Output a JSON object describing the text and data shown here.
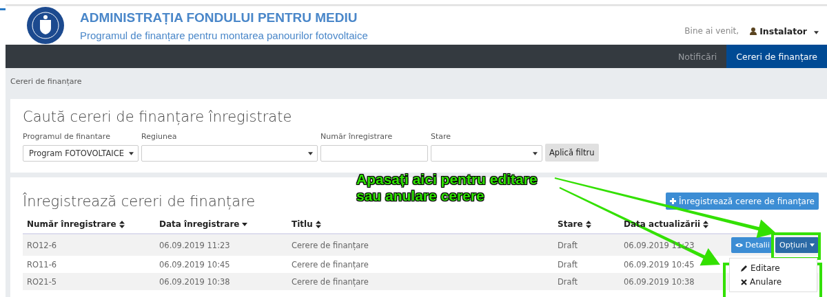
{
  "header": {
    "title": "ADMINISTRAȚIA FONDULUI PENTRU MEDIU",
    "subtitle": "Programul de finanțare pentru montarea panourilor fotovoltaice",
    "greeting": "Bine ai venit,",
    "user": "Instalator"
  },
  "nav": [
    {
      "label": "Notificări",
      "selected": false
    },
    {
      "label": "Cereri de finanțare",
      "selected": true
    }
  ],
  "breadcrumb": "Cereri de finanțare",
  "search": {
    "title": "Caută cereri de finanțare înregistrate",
    "fields": [
      {
        "kind": "select",
        "label": "Programul de finantare",
        "value": "Program FOTOVOLTAICE"
      },
      {
        "kind": "select",
        "label": "Regiunea"
      },
      {
        "kind": "input",
        "label": "Număr înregistrare"
      },
      {
        "kind": "select",
        "label": "Stare"
      }
    ],
    "apply_button": "Aplică filtru"
  },
  "list": {
    "title": "Înregistrează cereri de finanțare",
    "add_button": "Înregistrează cerere de finanțare",
    "columns": [
      {
        "label": "Număr înregistrare",
        "sorted": false
      },
      {
        "label": "Data înregistrare",
        "sorted": true
      },
      {
        "label": "Titlu",
        "sorted": false
      },
      {
        "label": "Stare",
        "sorted": false
      },
      {
        "label": "Data actualizării",
        "sorted": false
      }
    ],
    "rows": [
      {
        "cells": [
          "RO12-6",
          "06.09.2019 11:23",
          "Cerere de finanțare",
          "Draft",
          "06.09.2019 11:23"
        ],
        "details_button": "Detalii",
        "options_button": "Opțiuni",
        "menu": [
          {
            "kind": "edit",
            "label": "Editare"
          },
          {
            "kind": "cancel",
            "label": "Anulare"
          }
        ]
      },
      {
        "cells": [
          "RO11-6",
          "06.09.2019 10:45",
          "Cerere de finanțare",
          "Draft",
          "06.09.2019 10:45"
        ]
      },
      {
        "cells": [
          "RO21-5",
          "06.09.2019 10:38",
          "Cerere de finanțare",
          "Draft",
          "06.09.2019 10:38"
        ]
      }
    ]
  },
  "annotation": {
    "lines": [
      "Apasați aici pentru editare",
      "sau anulare cerere"
    ]
  }
}
